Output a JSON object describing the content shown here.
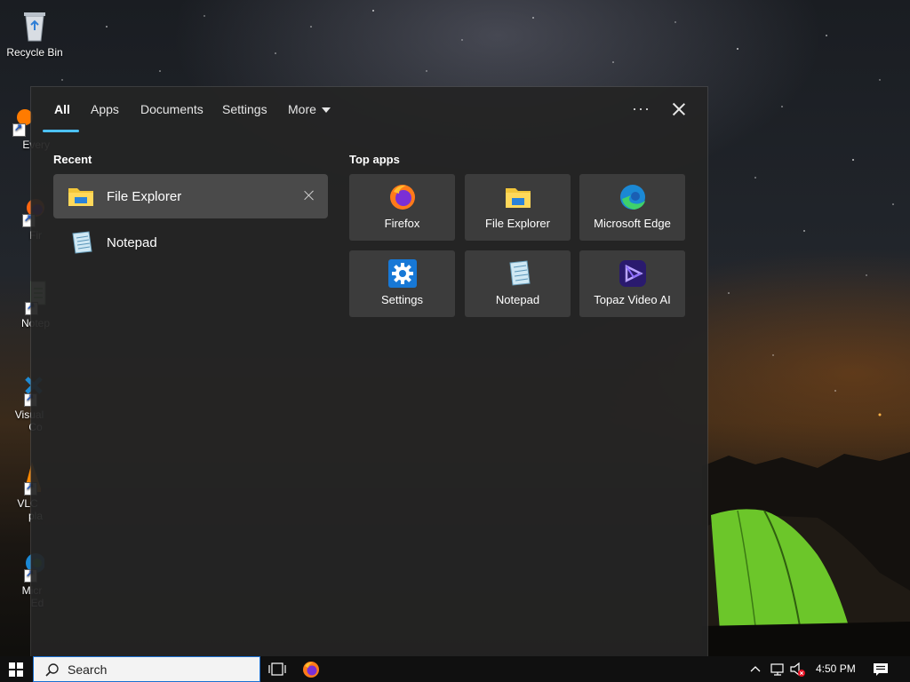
{
  "desktop": {
    "icons": [
      {
        "label": "Recycle Bin",
        "icon": "recycle-bin-icon"
      },
      {
        "label": "Every",
        "icon": "everything-icon"
      },
      {
        "label": "Fir",
        "icon": "firefox-icon"
      },
      {
        "label": "Notep",
        "icon": "notepad-icon"
      },
      {
        "label": "Visual",
        "label2": "Co",
        "icon": "vscode-icon"
      },
      {
        "label": "VLC",
        "label2": "pla",
        "icon": "vlc-icon"
      },
      {
        "label": "Micr",
        "label2": "Ed",
        "icon": "edge-icon"
      }
    ]
  },
  "search_panel": {
    "tabs": [
      {
        "label": "All",
        "active": true
      },
      {
        "label": "Apps"
      },
      {
        "label": "Documents"
      },
      {
        "label": "Settings"
      },
      {
        "label": "More"
      }
    ],
    "more_options_label": "···",
    "recent": {
      "title": "Recent",
      "items": [
        {
          "label": "File Explorer",
          "icon": "file-explorer-icon",
          "selected": true
        },
        {
          "label": "Notepad",
          "icon": "notepad-icon"
        }
      ]
    },
    "top_apps": {
      "title": "Top apps",
      "items": [
        {
          "label": "Firefox",
          "icon": "firefox-icon"
        },
        {
          "label": "File Explorer",
          "icon": "file-explorer-icon"
        },
        {
          "label": "Microsoft Edge",
          "icon": "edge-icon"
        },
        {
          "label": "Settings",
          "icon": "gear-icon"
        },
        {
          "label": "Notepad",
          "icon": "notepad-icon"
        },
        {
          "label": "Topaz Video AI",
          "icon": "topaz-icon"
        }
      ]
    }
  },
  "taskbar": {
    "search_placeholder": "Search",
    "clock": "4:50 PM"
  },
  "colors": {
    "accent": "#4cc2ff",
    "tile_bg": "#3c3c3c",
    "panel_bg": "#242424",
    "selected_bg": "#4a4a4a"
  }
}
